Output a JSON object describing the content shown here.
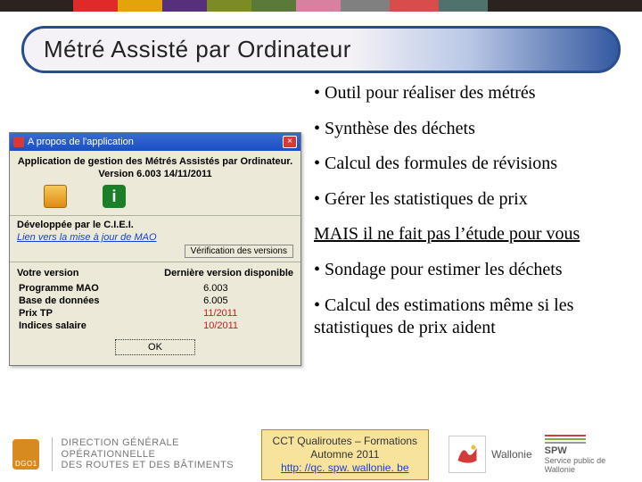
{
  "title": "Métré Assisté par Ordinateur",
  "dialog": {
    "titlebar": "A propos de l'application",
    "line1": "Application de gestion des Métrés Assistés par Ordinateur.",
    "version_line": "Version 6.003 14/11/2011",
    "dev_by": "Développée par le C.I.E.I.",
    "link": "Lien vers la mise à jour de MAO",
    "subhead_left": "Votre version",
    "subhead_right": "Dernière version disponible",
    "check_label": "Vérification des versions",
    "rows": [
      {
        "label": "Programme MAO",
        "val": "6.003"
      },
      {
        "label": "Base de données",
        "val": "6.005"
      },
      {
        "label": "Prix TP",
        "val": "11/2011",
        "date": true
      },
      {
        "label": "Indices salaire",
        "val": "10/2011",
        "date": true
      }
    ],
    "ok": "OK"
  },
  "bullets": {
    "b1": "• Outil pour réaliser des métrés",
    "b2": "• Synthèse des déchets",
    "b3": "• Calcul des formules de révisions",
    "b4": "• Gérer les statistiques de prix",
    "mais": "MAIS il ne fait pas l’étude pour vous",
    "b5": "• Sondage pour estimer les déchets",
    "b6": "• Calcul des estimations même si les statistiques de prix aident"
  },
  "footer": {
    "dgo_line1": "DIRECTION GÉNÉRALE OPÉRATIONNELLE",
    "dgo_line2": "DES ROUTES ET DES BÂTIMENTS",
    "cct_line1": "CCT Qualiroutes – Formations",
    "cct_line2": "Automne 2011",
    "cct_link": "http: //qc. spw. wallonie. be",
    "wallonie": "Wallonie",
    "spw1": "SPW",
    "spw2": "Service public de Wallonie"
  }
}
